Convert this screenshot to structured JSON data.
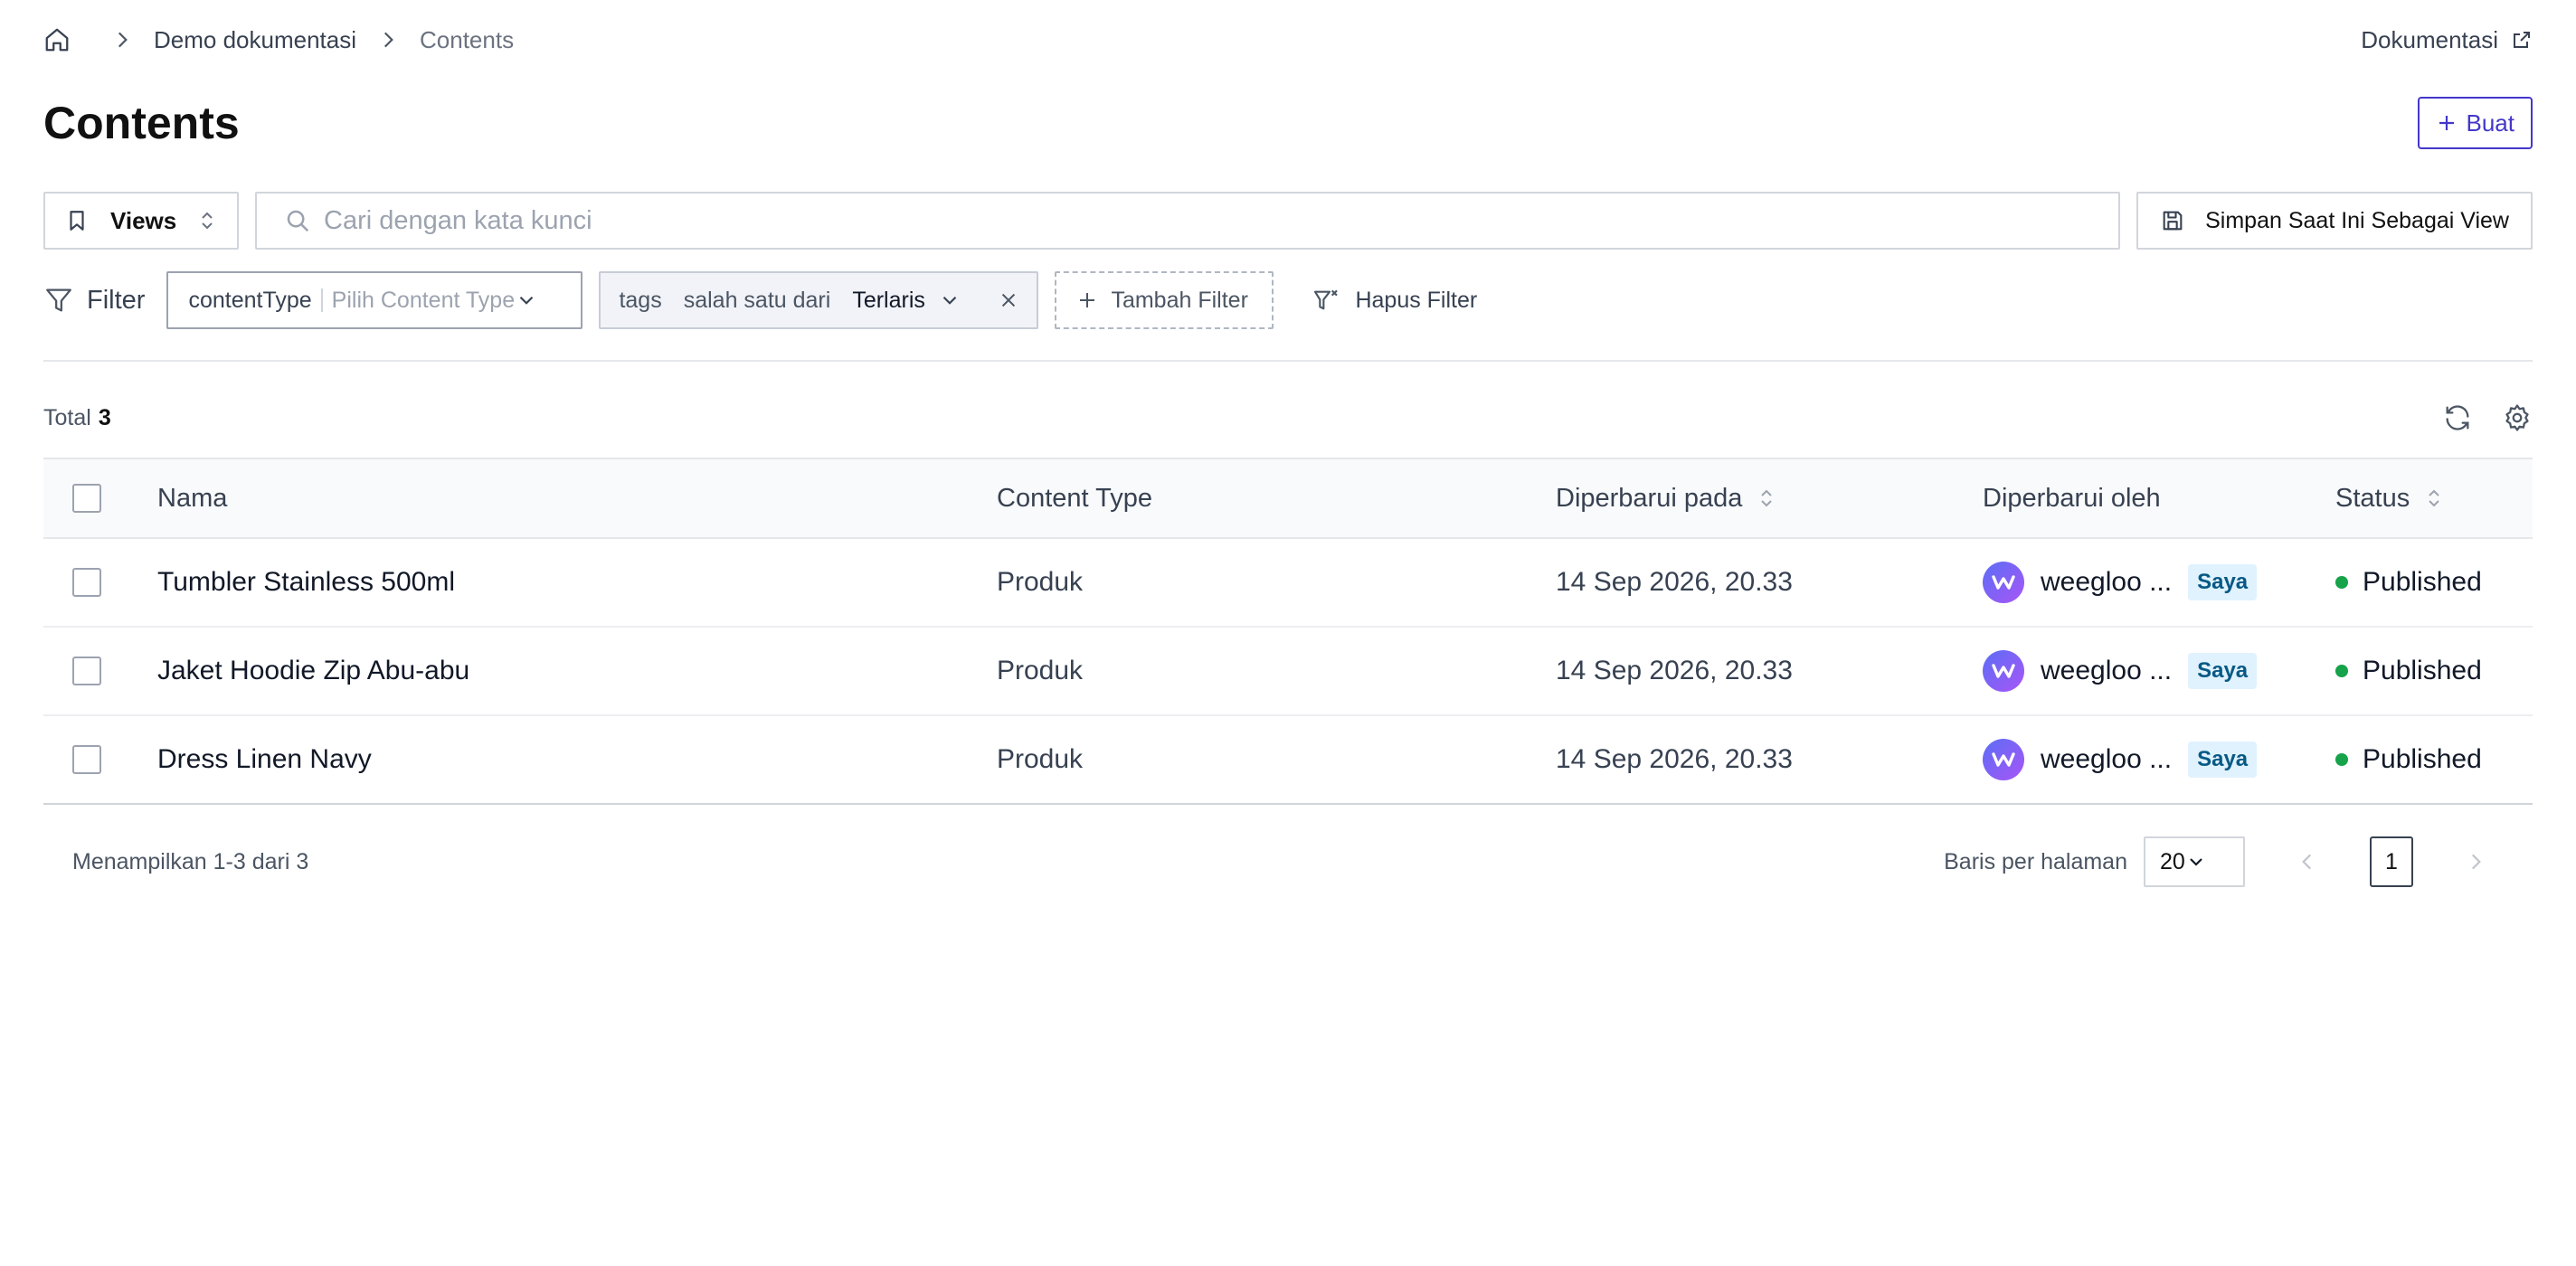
{
  "breadcrumb": {
    "items": [
      {
        "label": "Demo dokumentasi"
      },
      {
        "label": "Contents"
      }
    ],
    "doc_link": "Dokumentasi"
  },
  "header": {
    "title": "Contents",
    "create_label": "Buat"
  },
  "toolbar": {
    "views_label": "Views",
    "search_placeholder": "Cari dengan kata kunci",
    "save_view_label": "Simpan Saat Ini Sebagai View"
  },
  "filters": {
    "label": "Filter",
    "content_type": {
      "key": "contentType",
      "placeholder": "Pilih Content Type"
    },
    "tags": {
      "key": "tags",
      "operator": "salah satu dari",
      "value": "Terlaris"
    },
    "add_label": "Tambah Filter",
    "clear_label": "Hapus Filter"
  },
  "summary": {
    "total_label": "Total",
    "total_count": "3"
  },
  "table": {
    "columns": {
      "name": "Nama",
      "content_type": "Content Type",
      "updated_at": "Diperbarui pada",
      "updated_by": "Diperbarui oleh",
      "status": "Status"
    },
    "rows": [
      {
        "name": "Tumbler Stainless 500ml",
        "content_type": "Produk",
        "updated_at": "14 Sep 2026, 20.33",
        "updated_by": "weegloo ...",
        "badge": "Saya",
        "status": "Published"
      },
      {
        "name": "Jaket Hoodie Zip Abu-abu",
        "content_type": "Produk",
        "updated_at": "14 Sep 2026, 20.33",
        "updated_by": "weegloo ...",
        "badge": "Saya",
        "status": "Published"
      },
      {
        "name": "Dress Linen Navy",
        "content_type": "Produk",
        "updated_at": "14 Sep 2026, 20.33",
        "updated_by": "weegloo ...",
        "badge": "Saya",
        "status": "Published"
      }
    ]
  },
  "footer": {
    "showing": "Menampilkan 1-3 dari 3",
    "rows_per_page_label": "Baris per halaman",
    "rows_per_page": "20",
    "current_page": "1"
  },
  "colors": {
    "accent": "#4338ca",
    "status_published": "#16a34a",
    "badge_bg": "#e0f2fe",
    "badge_text": "#075985"
  },
  "icons": [
    "home-icon",
    "chevron-right-icon",
    "external-link-icon",
    "plus-icon",
    "bookmark-icon",
    "sort-updown-icon",
    "search-icon",
    "save-icon",
    "filter-icon",
    "chevron-down-icon",
    "close-icon",
    "filter-clear-icon",
    "refresh-icon",
    "gear-icon",
    "chevron-left-icon"
  ]
}
